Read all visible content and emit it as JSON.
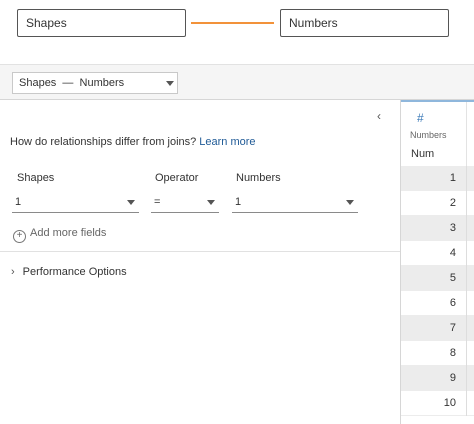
{
  "canvas": {
    "left_table": "Shapes",
    "right_table": "Numbers",
    "relationship_color": "#f2923a"
  },
  "toolbar": {
    "relationship_selector": "Shapes  —  Numbers"
  },
  "panel": {
    "question": "How do relationships differ from joins?",
    "learn_more": "Learn more",
    "labels": {
      "left": "Shapes",
      "operator": "Operator",
      "right": "Numbers"
    },
    "values": {
      "left": "1",
      "operator": "=",
      "right": "1"
    },
    "add_more_fields": "Add more fields",
    "performance_options": "Performance Options"
  },
  "grid": {
    "type_icon": "#",
    "source": "Numbers",
    "column": "Num",
    "rows": [
      "1",
      "2",
      "3",
      "4",
      "5",
      "6",
      "7",
      "8",
      "9",
      "10"
    ]
  }
}
